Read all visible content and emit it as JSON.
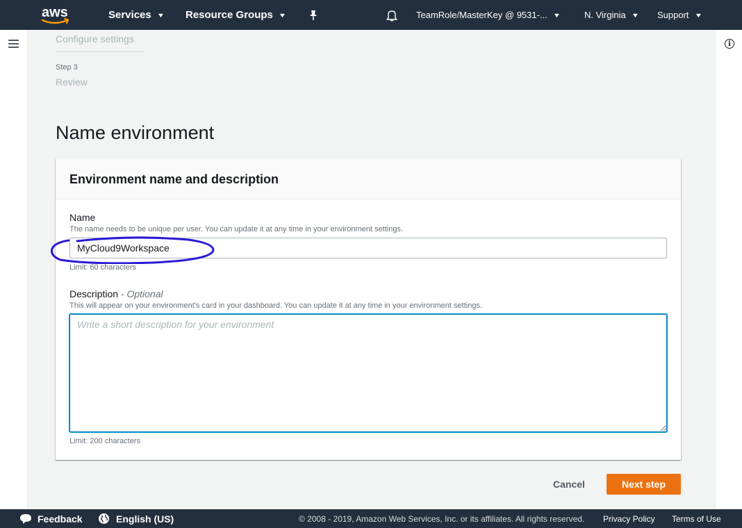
{
  "nav": {
    "logo_text": "aws",
    "services_label": "Services",
    "resource_groups_label": "Resource Groups",
    "account_label": "TeamRole/MasterKey @ 9531-...",
    "region_label": "N. Virginia",
    "support_label": "Support"
  },
  "steps": {
    "previous_step_title": "Configure settings",
    "current_step_label": "Step 3",
    "current_step_title": "Review"
  },
  "page": {
    "title": "Name environment"
  },
  "panel": {
    "title": "Environment name and description",
    "name_label": "Name",
    "name_description": "The name needs to be unique per user. You can update it at any time in your environment settings.",
    "name_value": "MyCloud9Workspace",
    "name_limit": "Limit: 60 characters",
    "description_label": "Description",
    "description_optional": " - Optional",
    "description_help": "This will appear on your environment's card in your dashboard. You can update it at any time in your environment settings.",
    "description_placeholder": "Write a short description for your environment",
    "description_value": "",
    "description_limit": "Limit: 200 characters"
  },
  "actions": {
    "cancel_label": "Cancel",
    "next_label": "Next step"
  },
  "footer": {
    "feedback_label": "Feedback",
    "language_label": "English (US)",
    "copyright": "© 2008 - 2019, Amazon Web Services, Inc. or its affiliates. All rights reserved.",
    "privacy_label": "Privacy Policy",
    "terms_label": "Terms of Use"
  },
  "colors": {
    "nav_bg": "#232f3e",
    "primary_button": "#ec7211",
    "focus_border": "#0073bb",
    "annotation_stroke": "#2b1ad6"
  },
  "icons": [
    "aws-logo",
    "chevron-down-icon",
    "pin-icon",
    "bell-icon",
    "hamburger-icon",
    "info-icon",
    "speech-bubble-icon",
    "globe-icon"
  ]
}
